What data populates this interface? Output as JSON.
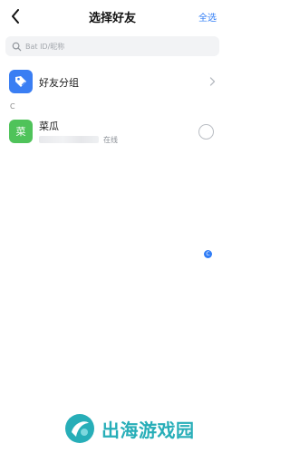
{
  "header": {
    "title": "选择好友",
    "select_all_label": "全选"
  },
  "search": {
    "placeholder": "Bat ID/昵称",
    "value": ""
  },
  "friend_group": {
    "label": "好友分组",
    "icon": "tag-icon",
    "icon_color": "#3a7ef3"
  },
  "contacts": {
    "section_letter": "C",
    "items": [
      {
        "avatar_text": "菜",
        "avatar_color": "#4fc35a",
        "name": "菜瓜",
        "status": "在线",
        "selected": false
      }
    ]
  },
  "floating_badge": {
    "text": "C"
  },
  "watermark": {
    "text": "出海游戏园"
  },
  "colors": {
    "accent": "#2f7cf6",
    "watermark": "#27aeb8"
  }
}
